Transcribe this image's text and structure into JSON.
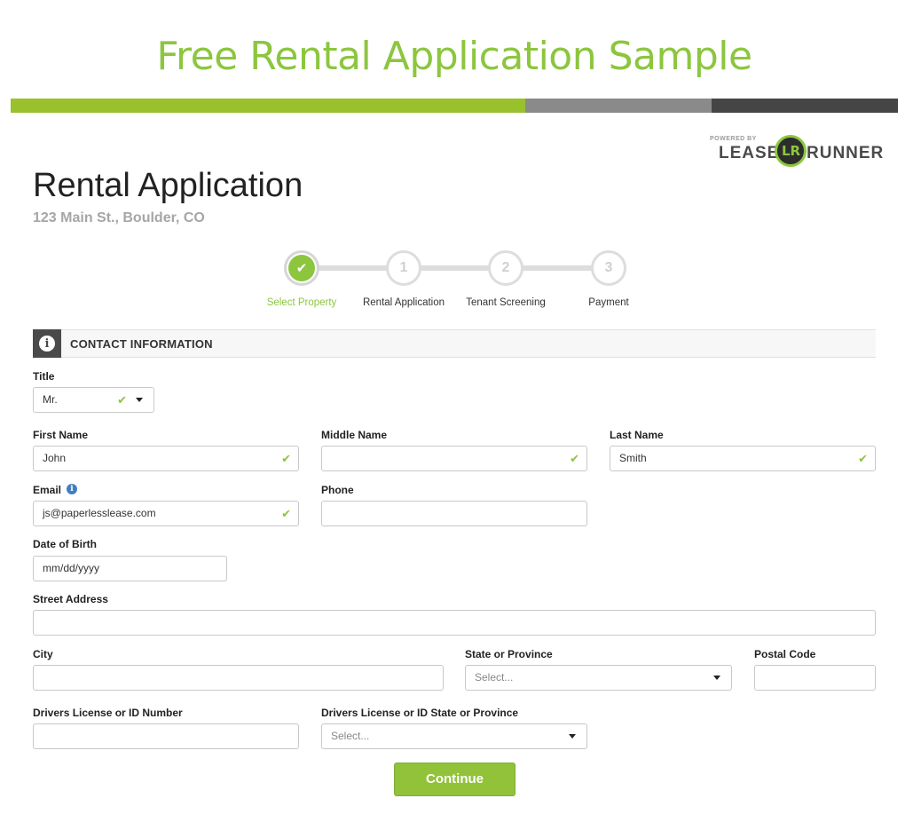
{
  "banner": {
    "title": "Free Rental Application Sample",
    "title_color": "#8cc63f",
    "bar_colors": [
      "#99c12e",
      "#8a8a8a",
      "#454545"
    ]
  },
  "logo": {
    "powered_by": "POWERED BY",
    "brand_left": "LEASE",
    "brand_mark": "LR",
    "brand_right": "RUNNER"
  },
  "header": {
    "title": "Rental Application",
    "address": "123 Main St., Boulder, CO",
    "address_color": "#a6a6a6"
  },
  "stepper": {
    "accent_color": "#8cc63f",
    "steps": [
      {
        "marker": "✔",
        "label": "Select Property",
        "active": true
      },
      {
        "marker": "1",
        "label": "Rental Application",
        "active": false
      },
      {
        "marker": "2",
        "label": "Tenant Screening",
        "active": false
      },
      {
        "marker": "3",
        "label": "Payment",
        "active": false
      }
    ]
  },
  "section": {
    "icon": "info-icon",
    "title": "CONTACT INFORMATION"
  },
  "form": {
    "title_label": "Title",
    "title_value": "Mr.",
    "first_name_label": "First Name",
    "first_name_value": "John",
    "middle_name_label": "Middle Name",
    "middle_name_value": "",
    "last_name_label": "Last Name",
    "last_name_value": "Smith",
    "email_label": "Email",
    "email_value": "js@paperlesslease.com",
    "phone_label": "Phone",
    "phone_value": "",
    "dob_label": "Date of Birth",
    "dob_placeholder": "mm/dd/yyyy",
    "street_label": "Street Address",
    "street_value": "",
    "city_label": "City",
    "city_value": "",
    "state_label": "State or Province",
    "state_placeholder": "Select...",
    "postal_label": "Postal Code",
    "postal_value": "",
    "dl_label": "Drivers License or ID Number",
    "dl_value": "",
    "dl_state_label": "Drivers License or ID State or Province",
    "dl_state_placeholder": "Select...",
    "valid_mark": "✔",
    "info_mark": "i"
  },
  "actions": {
    "continue_label": "Continue",
    "continue_color": "#92c13a"
  }
}
